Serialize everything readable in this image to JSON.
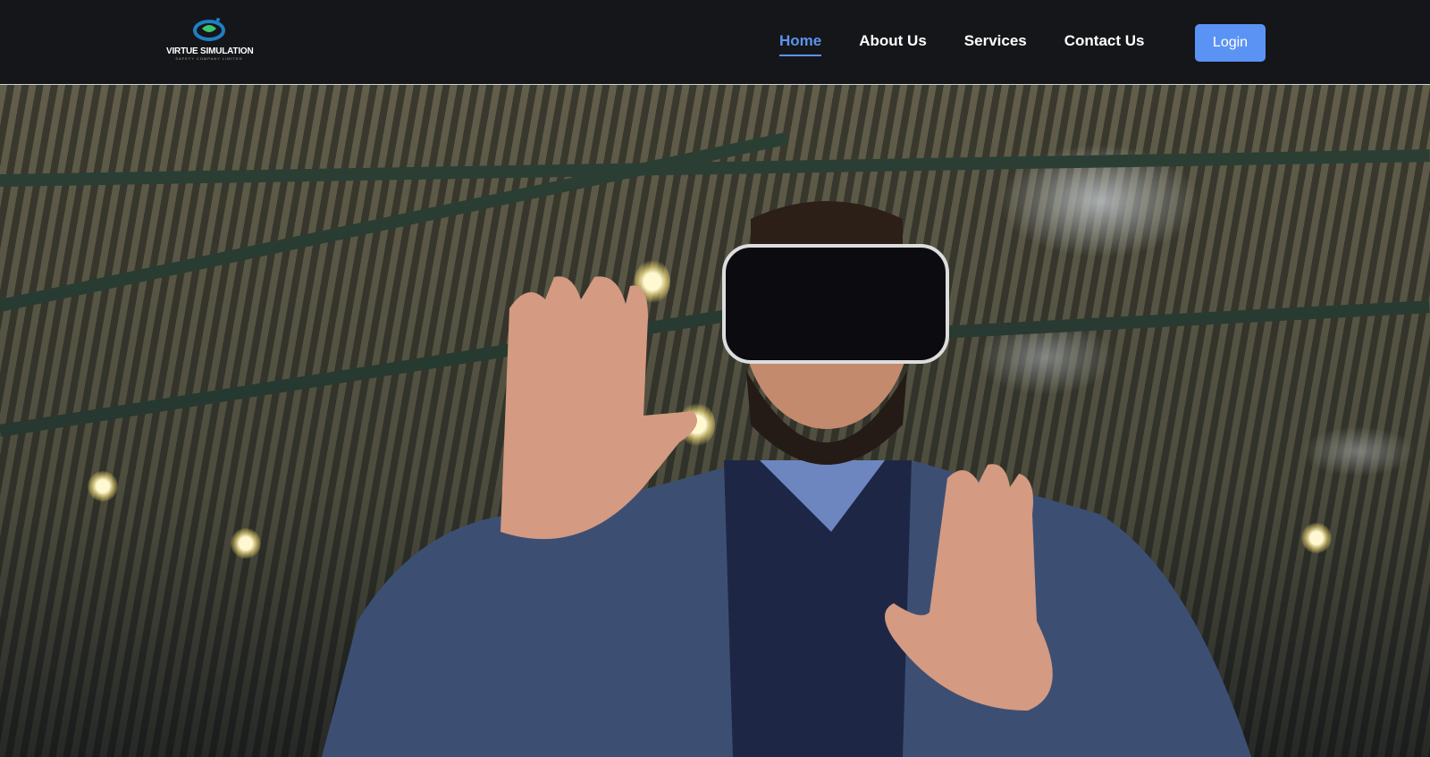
{
  "brand": {
    "name": "VIRTUE SIMULATION",
    "tagline": "SAFETY COMPANY LIMITED"
  },
  "nav": {
    "items": [
      {
        "label": "Home",
        "active": true
      },
      {
        "label": "About Us",
        "active": false
      },
      {
        "label": "Services",
        "active": false
      },
      {
        "label": "Contact Us",
        "active": false
      }
    ],
    "login_label": "Login"
  },
  "colors": {
    "accent": "#5b93f5",
    "header_bg": "#151619"
  }
}
